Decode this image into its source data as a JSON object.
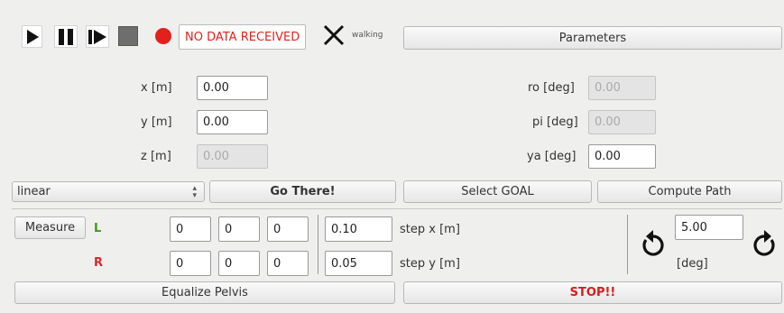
{
  "toolbar": {
    "status_text": "NO DATA RECEIVED",
    "walking_label": "walking",
    "parameters_label": "Parameters",
    "status_color": "#e3211c"
  },
  "position": {
    "x_label": "x [m]",
    "x_value": "0.00",
    "y_label": "y [m]",
    "y_value": "0.00",
    "z_label": "z [m]",
    "z_value": "0.00"
  },
  "orientation": {
    "ro_label": "ro [deg]",
    "ro_value": "0.00",
    "pi_label": "pi [deg]",
    "pi_value": "0.00",
    "ya_label": "ya [deg]",
    "ya_value": "0.00"
  },
  "actions": {
    "mode_selected": "linear",
    "go_there_label": "Go There!",
    "select_goal_label": "Select GOAL",
    "compute_path_label": "Compute Path"
  },
  "steps": {
    "measure_label": "Measure",
    "left_label": "L",
    "right_label": "R",
    "left_values": [
      "0",
      "0",
      "0"
    ],
    "right_values": [
      "0",
      "0",
      "0"
    ],
    "step_x_value": "0.10",
    "step_x_label": "step x [m]",
    "step_y_value": "0.05",
    "step_y_label": "step y [m]",
    "left_color": "#3a9c1e",
    "right_color": "#d22a2a"
  },
  "rotation": {
    "deg_value": "5.00",
    "deg_label": "[deg]"
  },
  "bottom": {
    "equalize_label": "Equalize Pelvis",
    "stop_label": "STOP!!",
    "stop_color": "#d91c1c"
  }
}
